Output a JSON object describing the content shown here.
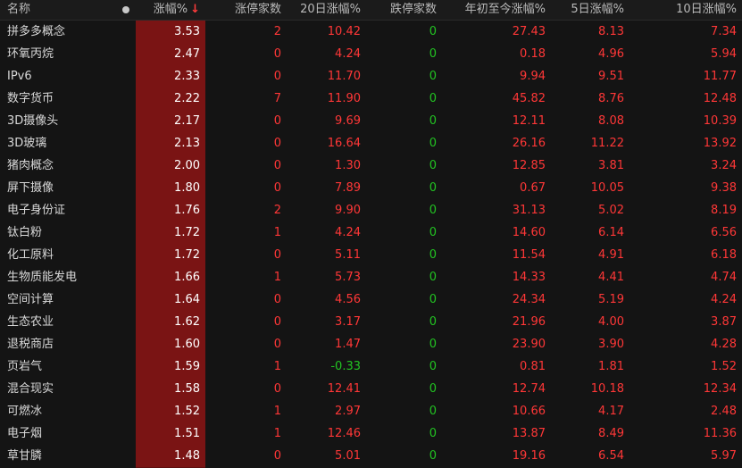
{
  "columns": {
    "name": "名称",
    "pct": "涨幅%",
    "limitup": "涨停家数",
    "d20": "20日涨幅%",
    "limitdown": "跌停家数",
    "ytd": "年初至今涨幅%",
    "d5": "5日涨幅%",
    "d10": "10日涨幅%"
  },
  "colors": {
    "up": "#ff3737",
    "down": "#22c322",
    "highlight_column": "#7a1414"
  },
  "rows": [
    {
      "name": "拼多多概念",
      "pct": "3.53",
      "limitup": "2",
      "d20": "10.42",
      "limitdown": "0",
      "ytd": "27.43",
      "d5": "8.13",
      "d10": "7.34"
    },
    {
      "name": "环氧丙烷",
      "pct": "2.47",
      "limitup": "0",
      "d20": "4.24",
      "limitdown": "0",
      "ytd": "0.18",
      "d5": "4.96",
      "d10": "5.94"
    },
    {
      "name": "IPv6",
      "pct": "2.33",
      "limitup": "0",
      "d20": "11.70",
      "limitdown": "0",
      "ytd": "9.94",
      "d5": "9.51",
      "d10": "11.77"
    },
    {
      "name": "数字货币",
      "pct": "2.22",
      "limitup": "7",
      "d20": "11.90",
      "limitdown": "0",
      "ytd": "45.82",
      "d5": "8.76",
      "d10": "12.48"
    },
    {
      "name": "3D摄像头",
      "pct": "2.17",
      "limitup": "0",
      "d20": "9.69",
      "limitdown": "0",
      "ytd": "12.11",
      "d5": "8.08",
      "d10": "10.39"
    },
    {
      "name": "3D玻璃",
      "pct": "2.13",
      "limitup": "0",
      "d20": "16.64",
      "limitdown": "0",
      "ytd": "26.16",
      "d5": "11.22",
      "d10": "13.92"
    },
    {
      "name": "猪肉概念",
      "pct": "2.00",
      "limitup": "0",
      "d20": "1.30",
      "limitdown": "0",
      "ytd": "12.85",
      "d5": "3.81",
      "d10": "3.24"
    },
    {
      "name": "屏下摄像",
      "pct": "1.80",
      "limitup": "0",
      "d20": "7.89",
      "limitdown": "0",
      "ytd": "0.67",
      "d5": "10.05",
      "d10": "9.38"
    },
    {
      "name": "电子身份证",
      "pct": "1.76",
      "limitup": "2",
      "d20": "9.90",
      "limitdown": "0",
      "ytd": "31.13",
      "d5": "5.02",
      "d10": "8.19"
    },
    {
      "name": "钛白粉",
      "pct": "1.72",
      "limitup": "1",
      "d20": "4.24",
      "limitdown": "0",
      "ytd": "14.60",
      "d5": "6.14",
      "d10": "6.56"
    },
    {
      "name": "化工原料",
      "pct": "1.72",
      "limitup": "0",
      "d20": "5.11",
      "limitdown": "0",
      "ytd": "11.54",
      "d5": "4.91",
      "d10": "6.18"
    },
    {
      "name": "生物质能发电",
      "pct": "1.66",
      "limitup": "1",
      "d20": "5.73",
      "limitdown": "0",
      "ytd": "14.33",
      "d5": "4.41",
      "d10": "4.74"
    },
    {
      "name": "空间计算",
      "pct": "1.64",
      "limitup": "0",
      "d20": "4.56",
      "limitdown": "0",
      "ytd": "24.34",
      "d5": "5.19",
      "d10": "4.24"
    },
    {
      "name": "生态农业",
      "pct": "1.62",
      "limitup": "0",
      "d20": "3.17",
      "limitdown": "0",
      "ytd": "21.96",
      "d5": "4.00",
      "d10": "3.87"
    },
    {
      "name": "退税商店",
      "pct": "1.60",
      "limitup": "0",
      "d20": "1.47",
      "limitdown": "0",
      "ytd": "23.90",
      "d5": "3.90",
      "d10": "4.28"
    },
    {
      "name": "页岩气",
      "pct": "1.59",
      "limitup": "1",
      "d20": "-0.33",
      "limitdown": "0",
      "ytd": "0.81",
      "d5": "1.81",
      "d10": "1.52"
    },
    {
      "name": "混合现实",
      "pct": "1.58",
      "limitup": "0",
      "d20": "12.41",
      "limitdown": "0",
      "ytd": "12.74",
      "d5": "10.18",
      "d10": "12.34"
    },
    {
      "name": "可燃冰",
      "pct": "1.52",
      "limitup": "1",
      "d20": "2.97",
      "limitdown": "0",
      "ytd": "10.66",
      "d5": "4.17",
      "d10": "2.48"
    },
    {
      "name": "电子烟",
      "pct": "1.51",
      "limitup": "1",
      "d20": "12.46",
      "limitdown": "0",
      "ytd": "13.87",
      "d5": "8.49",
      "d10": "11.36"
    },
    {
      "name": "草甘膦",
      "pct": "1.48",
      "limitup": "0",
      "d20": "5.01",
      "limitdown": "0",
      "ytd": "19.16",
      "d5": "6.54",
      "d10": "5.97"
    }
  ]
}
